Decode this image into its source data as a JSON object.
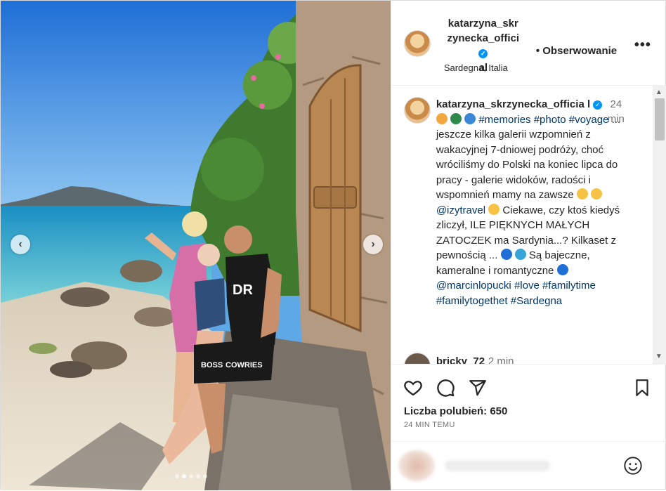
{
  "header": {
    "username_line1": "katarzyna_skr",
    "username_line2": "zynecka_offici",
    "username_line3": "al",
    "verified_glyph": "✓",
    "separator": "•",
    "follow_label": "Obserwowanie",
    "more_glyph": "•••",
    "location": "Sardegna, Italia"
  },
  "caption": {
    "username": "katarzyna_skrzynecka_officia l",
    "time_value": "24",
    "time_unit": "min",
    "hashtags_line": "#memories #photo #voyage",
    "ellipsis": "...",
    "text1": "jeszcze kilka galerii wzpomnień z wakacyjnej 7-dniowej podróży, choć wróciliśmy do Polski na koniec lipca do pracy - galerie widoków, radości i wspomnień mamy na zawsze",
    "mention1": "@izytravel",
    "text2": "Ciekawe, czy ktoś kiedyś zliczył, ILE PIĘKNYCH MAŁYCH ZATOCZEK ma Sardynia...? Kilkaset z pewnością ...",
    "text3": "Są bajeczne, kameralne i romantyczne",
    "mention2": "@marcinlopucki",
    "tag_love": "#love",
    "tag_familytime": "#familytime",
    "tag_familytogethet": "#familytogethet",
    "tag_sardegna": "#Sardegna"
  },
  "next_comment": {
    "username": "bricky_72",
    "time": "2 min"
  },
  "actions": {
    "icons": [
      "heart-icon",
      "comment-icon",
      "share-icon",
      "bookmark-icon"
    ],
    "likes": "Liczba polubień: 650",
    "posted": "24 MIN TEMU"
  },
  "photo": {
    "prev_glyph": "‹",
    "next_glyph": "›",
    "carousel_dots": 5,
    "active_dot": 2,
    "shirt_text": "DR",
    "shorts_text": "BOSS",
    "shorts_text2": "COWRIES"
  },
  "colors": {
    "link": "#00376b",
    "verified": "#0095f6",
    "muted": "#737373"
  }
}
